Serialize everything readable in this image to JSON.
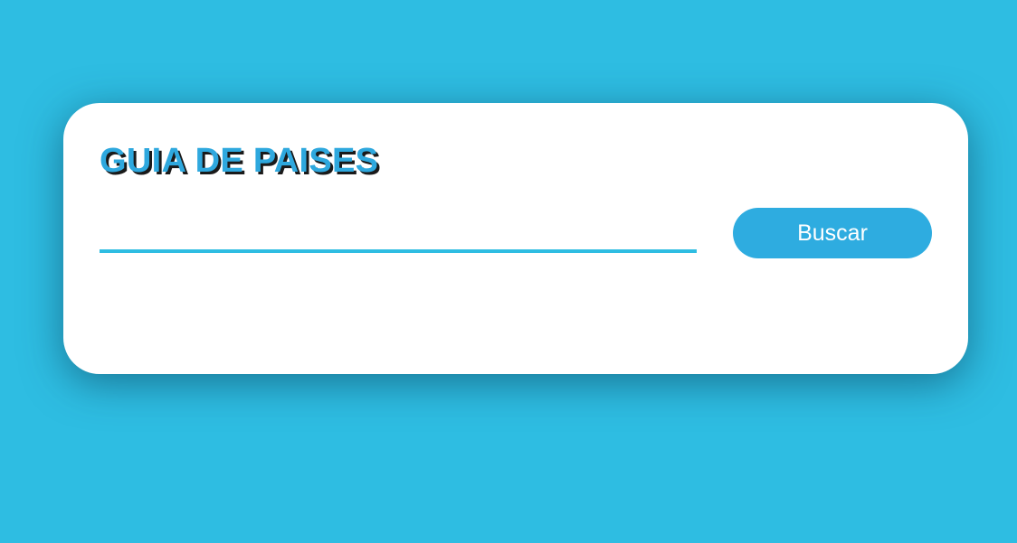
{
  "card": {
    "title": "GUIA DE PAISES"
  },
  "search": {
    "value": "",
    "placeholder": ""
  },
  "search_button": {
    "label": "Buscar"
  },
  "colors": {
    "background": "#2ebde2",
    "accent": "#2eace0",
    "title": "#2ea8de",
    "title_shadow": "#1a1a1a",
    "card": "#ffffff"
  }
}
